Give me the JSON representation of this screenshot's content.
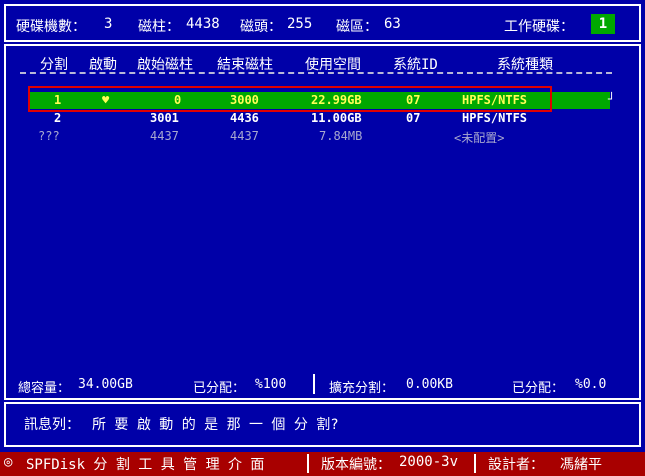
{
  "header": {
    "disk_count_label": "硬碟機數：",
    "disk_count": "3",
    "cylinders_label": "磁柱：",
    "cylinders": "4438",
    "heads_label": "磁頭：",
    "heads": "255",
    "sectors_label": "磁區：",
    "sectors": "63",
    "working_disk_label": "工作硬碟：",
    "working_disk": "1"
  },
  "table": {
    "columns": [
      "分割",
      "啟動",
      "啟始磁柱",
      "結束磁柱",
      "使用空間",
      "系統ID",
      "系統種類"
    ],
    "rows": [
      {
        "partition": "1",
        "boot": "♥",
        "start": "0",
        "end": "3000",
        "size": "22.99GB",
        "sysid": "07",
        "systype": "HPFS/NTFS"
      },
      {
        "partition": "2",
        "boot": "",
        "start": "3001",
        "end": "4436",
        "size": "11.00GB",
        "sysid": "07",
        "systype": "HPFS/NTFS"
      },
      {
        "partition": "???",
        "boot": "",
        "start": "4437",
        "end": "4437",
        "size": "7.84MB",
        "sysid": "",
        "systype": "<未配置>"
      }
    ],
    "row_tail": "┘"
  },
  "summary": {
    "total_label": "總容量：",
    "total": "34.00GB",
    "allocated_label": "已分配：",
    "allocated": "%100",
    "extended_label": "擴充分割：",
    "extended": "0.00KB",
    "ext_allocated_label": "已分配：",
    "ext_allocated": "%0.0"
  },
  "message": {
    "label": "訊息列：",
    "text": "所 要 啟 動 的 是 那 一 個 分 割?"
  },
  "status_bar": {
    "icon": "◎",
    "app_name": "SPFDisk 分 割 工 具 管 理 介 面",
    "version_label": "版本編號：",
    "version": "2000-3v",
    "designer_label": "設計者：",
    "designer": "馮緒平"
  },
  "colors": {
    "background": "#0000a8",
    "selected_row": "#00a800",
    "selected_text": "#ffff55",
    "status_bar": "#a80000",
    "highlight_box": "#e00000"
  }
}
